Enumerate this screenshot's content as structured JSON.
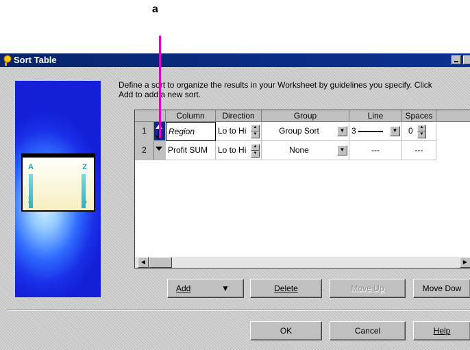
{
  "callout": {
    "label": "a"
  },
  "window": {
    "title": "Sort Table",
    "controls": [
      "minimize",
      "close"
    ]
  },
  "description": "Define a sort to organize the results in your Worksheet by guidelines you specify. Click Add to add a new sort.",
  "grid": {
    "headers": [
      "",
      "Column",
      "Direction",
      "Group",
      "Line",
      "Spaces"
    ],
    "rows": [
      {
        "num": "1",
        "column": "Region",
        "direction": "Lo to Hi",
        "group": "Group Sort",
        "line": "3",
        "spaces": "0"
      },
      {
        "num": "2",
        "column": "Profit SUM",
        "direction": "Lo to Hi",
        "group": "None",
        "line": "---",
        "spaces": "---"
      }
    ]
  },
  "buttons": {
    "add": "Add",
    "delete": "Delete",
    "move_up": "Move Up",
    "move_down": "Move Dow",
    "ok": "OK",
    "cancel": "Cancel",
    "help": "Help"
  },
  "art": {
    "letters": [
      "A",
      "Z",
      "Z",
      "A"
    ]
  },
  "colors": {
    "titlebar": "#0a2c84",
    "callout_line": "#e000c8",
    "dialog_bg": "#c6c6c6"
  }
}
